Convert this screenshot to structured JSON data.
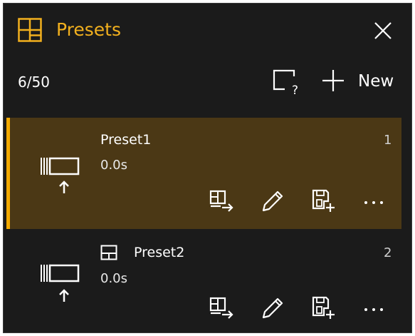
{
  "header": {
    "title": "Presets"
  },
  "toolbar": {
    "count": "6/50",
    "new_label": "New"
  },
  "presets": [
    {
      "name": "Preset1",
      "duration": "0.0s",
      "index": "1",
      "selected": true
    },
    {
      "name": "Preset2",
      "duration": "0.0s",
      "index": "2",
      "selected": false
    }
  ],
  "colors": {
    "accent": "#f2a900",
    "title": "#f2b01e",
    "selected_bg": "#4b3815",
    "panel_bg": "#1b1b1b"
  },
  "icons": [
    "layout-grid-icon",
    "close-icon",
    "help-screen-icon",
    "plus-icon",
    "preset-thumbnail-icon",
    "layout-icon",
    "apply-preset-icon",
    "edit-pencil-icon",
    "save-as-preset-icon",
    "more-icon"
  ]
}
